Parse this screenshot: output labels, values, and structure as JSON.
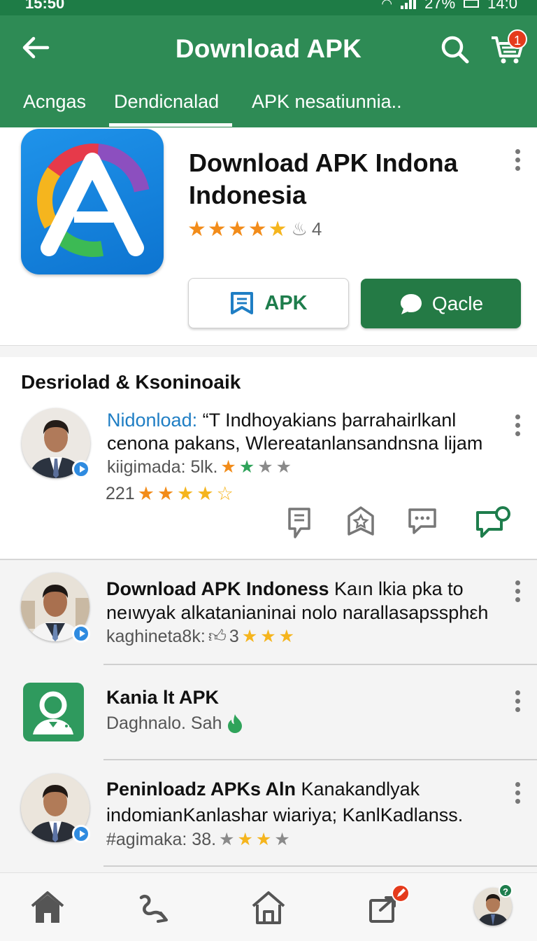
{
  "status_bar": {
    "time": "15:50",
    "battery": "27%",
    "extra": "14:0"
  },
  "app_bar": {
    "title": "Download APK",
    "cart_count": "1"
  },
  "tabs": [
    {
      "label": "Acngas"
    },
    {
      "label": "Dendicnalad"
    },
    {
      "label": "APK nesatiunnia.."
    }
  ],
  "active_tab": 1,
  "app": {
    "title": "Download APK Indona Indonesia",
    "rating_stars": 5,
    "rating_value": "4",
    "apk_button": "APK",
    "primary_button": "Qacle"
  },
  "section": {
    "title": "Desriolad & Ksoninoaik",
    "review": {
      "prefix": "Nidonload:",
      "line1": "“T Indhoyakians þarrahairlkanl",
      "line2": "cenona pakans, Wlereatanlansandnsna lijam",
      "meta1": "kiigimada: 5lk.",
      "meta2": "221"
    }
  },
  "list": [
    {
      "title_bold": "Download APK  Indoness",
      "title_rest": " Kaın lkia pka to",
      "line2": "neıwyak alkatanianinai nolo narallasapssphεh",
      "meta": "kaghineta8k:",
      "meta_count": "3"
    },
    {
      "title_bold": "Kania lt APK",
      "meta": "Daghnalo. Sah"
    },
    {
      "title_bold": "Peninloadz APKs Aln",
      "title_rest": " Kanakandlyak",
      "line2": "indomianKanlashar wiariya; KanlKadlanss.",
      "meta": "#agimaka: 38."
    }
  ],
  "bottom_nav": [
    "home-icon",
    "route-icon",
    "house-outline-icon",
    "share-icon",
    "profile-avatar"
  ],
  "colors": {
    "primary": "#2e8b55",
    "dark_green": "#247a45",
    "accent_blue": "#1f7ec4",
    "star_orange": "#f28c1a",
    "star_gold": "#f5b51e",
    "badge_red": "#e53b1c"
  }
}
